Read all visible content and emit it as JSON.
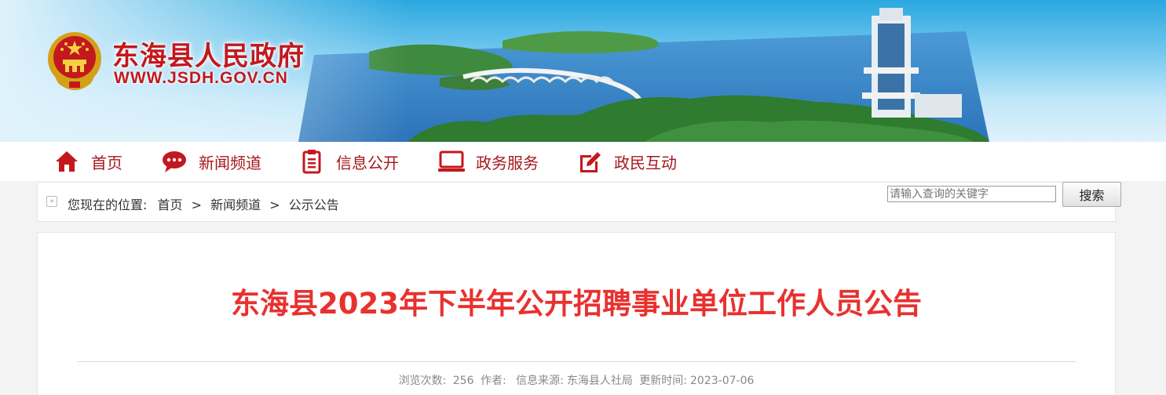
{
  "site": {
    "title": "东海县人民政府",
    "url": "WWW.JSDH.GOV.CN"
  },
  "nav": [
    {
      "label": "首页",
      "icon": "home-icon"
    },
    {
      "label": "新闻频道",
      "icon": "chat-bubble-icon"
    },
    {
      "label": "信息公开",
      "icon": "document-icon"
    },
    {
      "label": "政务服务",
      "icon": "monitor-icon"
    },
    {
      "label": "政民互动",
      "icon": "edit-icon"
    }
  ],
  "breadcrumb": {
    "prefix": "您现在的位置:",
    "items": [
      "首页",
      "新闻频道",
      "公示公告"
    ],
    "separator": ">"
  },
  "search": {
    "placeholder": "请输入查询的关键字",
    "button": "搜索"
  },
  "article": {
    "title": "东海县2023年下半年公开招聘事业单位工作人员公告",
    "meta": {
      "views_label": "浏览次数:",
      "views": "256",
      "author_label": "作者:",
      "author": "",
      "source_label": "信息来源:",
      "source": "东海县人社局",
      "updated_label": "更新时间:",
      "updated": "2023-07-06"
    }
  },
  "colors": {
    "brand_red": "#c3181e",
    "nav_red": "#a6171c",
    "title_red": "#e8312f"
  }
}
